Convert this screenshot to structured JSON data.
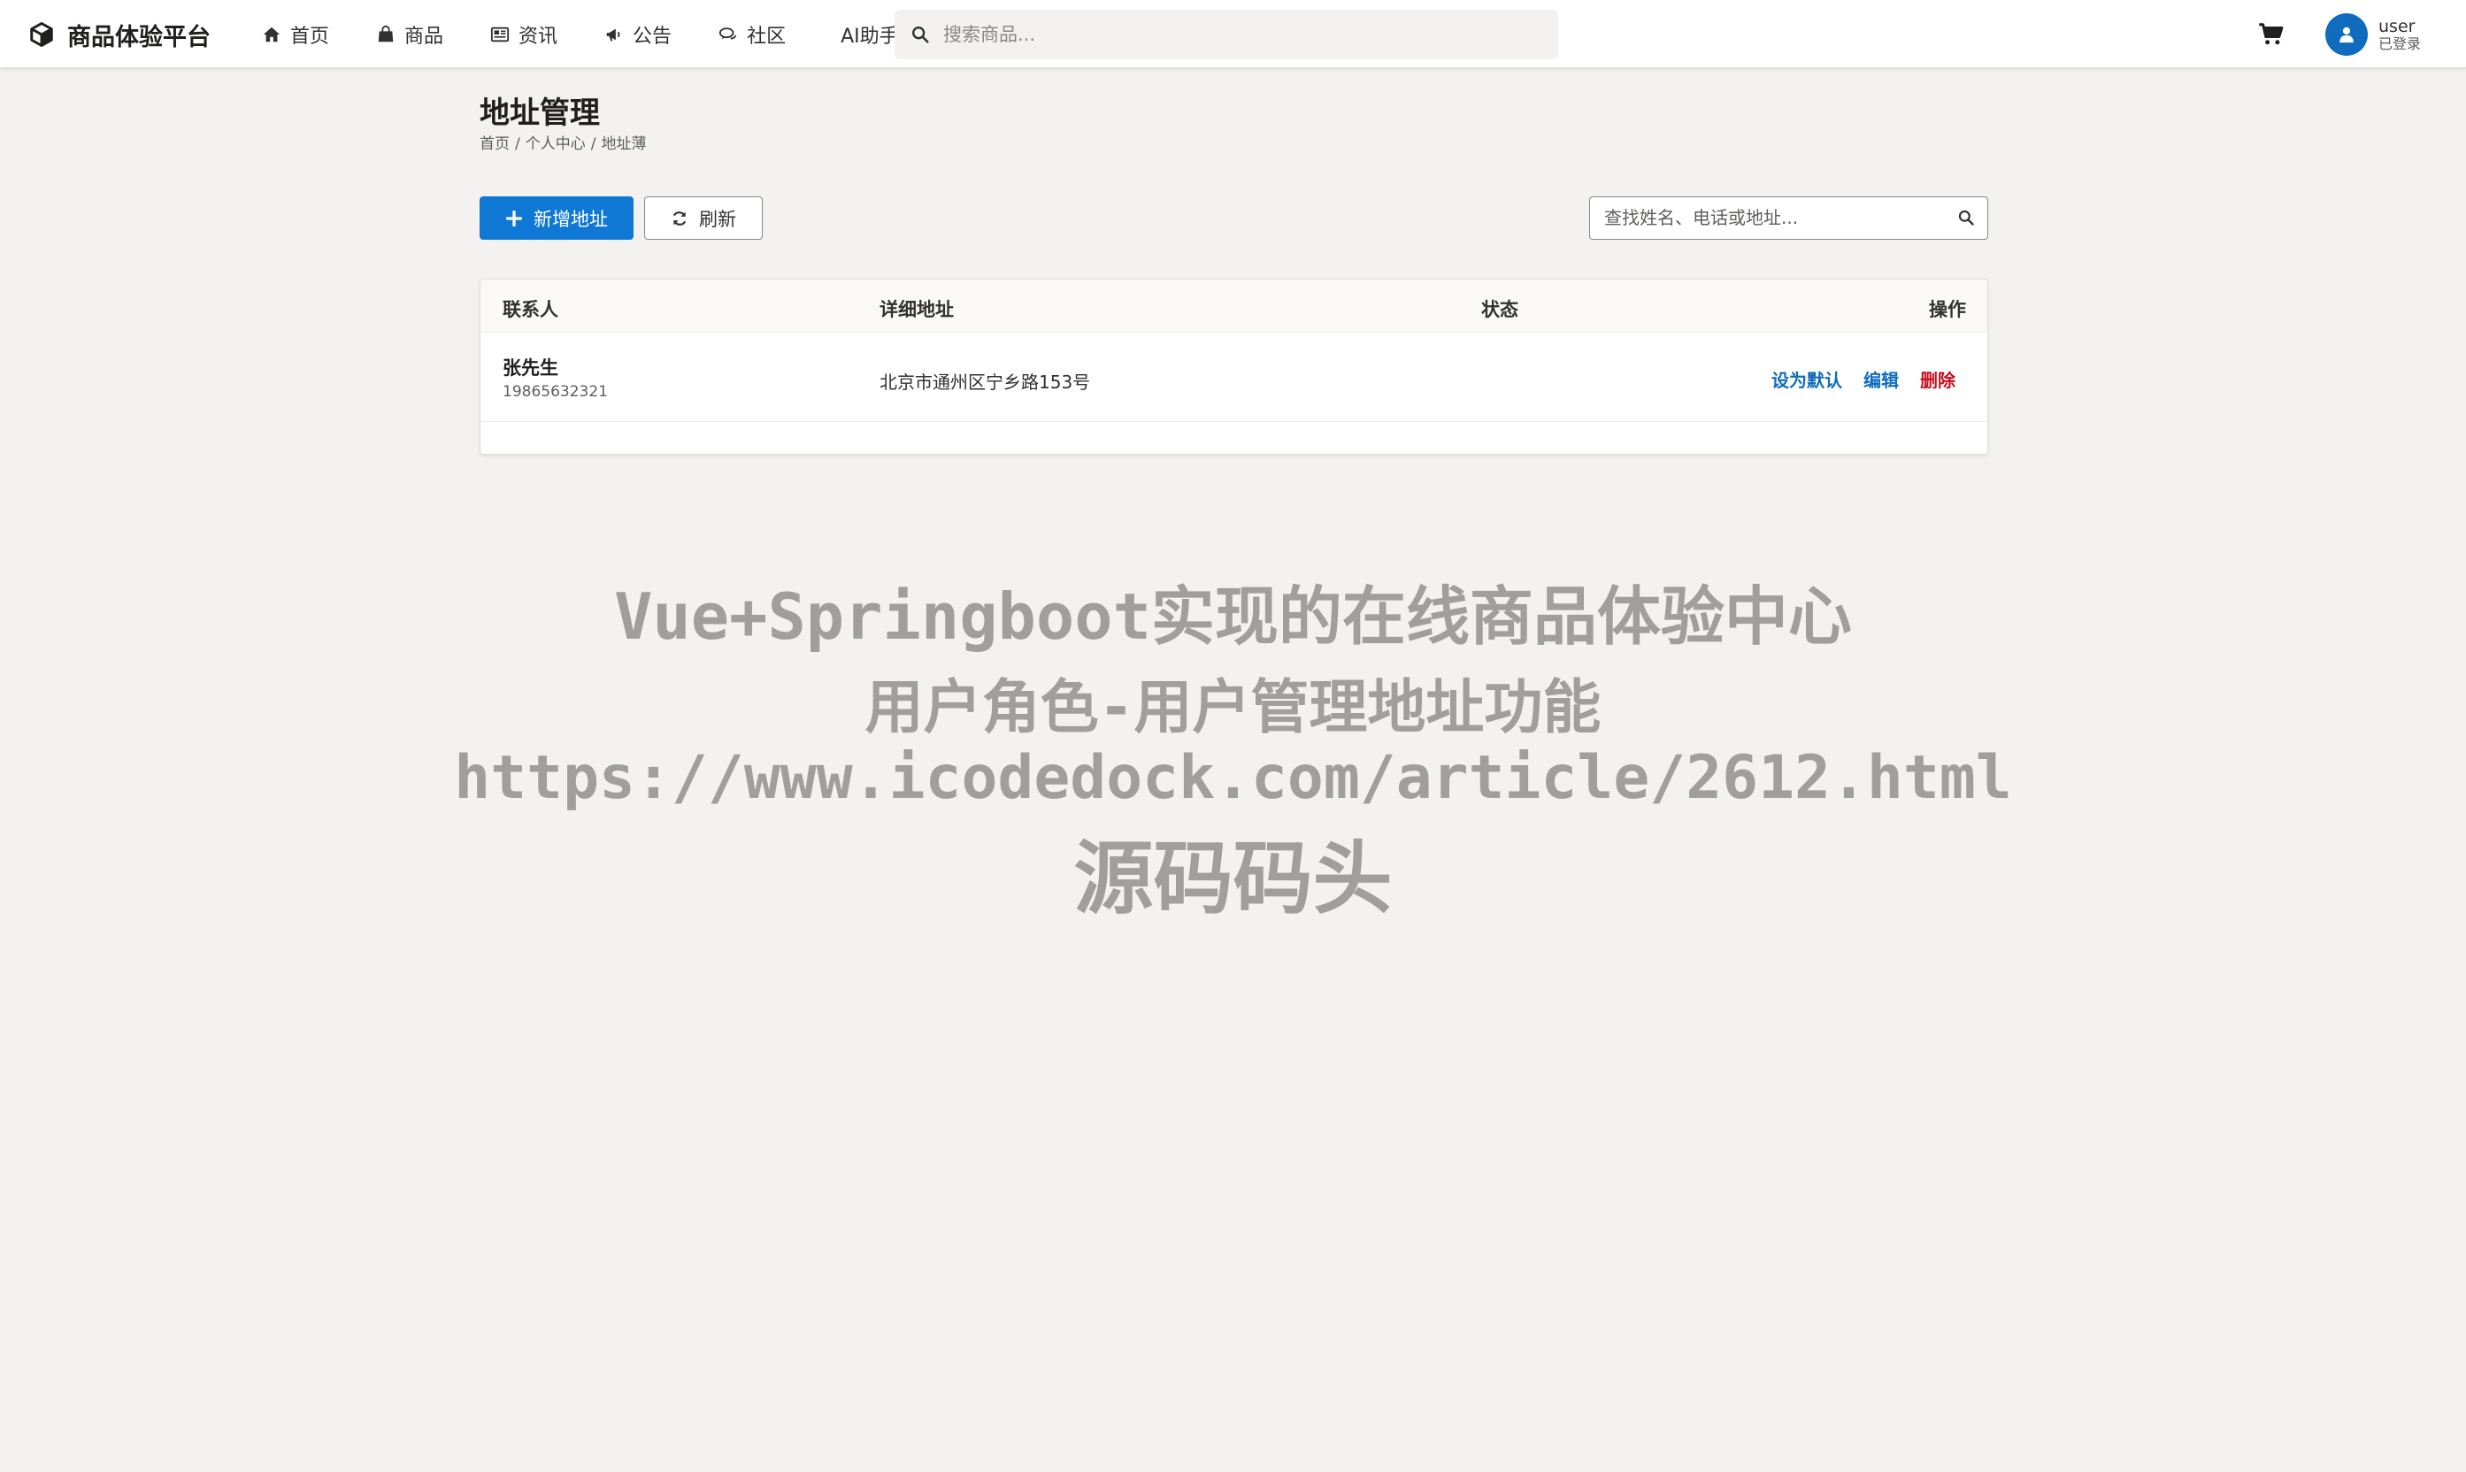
{
  "brand": {
    "title": "商品体验平台",
    "icon": "cube-icon"
  },
  "nav": {
    "items": [
      {
        "label": "首页",
        "icon": "home-icon"
      },
      {
        "label": "商品",
        "icon": "shopping-bag-icon"
      },
      {
        "label": "资讯",
        "icon": "newspaper-icon"
      },
      {
        "label": "公告",
        "icon": "bullhorn-icon"
      },
      {
        "label": "社区",
        "icon": "comments-icon"
      },
      {
        "label": "AI助手"
      }
    ]
  },
  "search": {
    "placeholder": "搜索商品...",
    "value": ""
  },
  "cart": {
    "icon": "cart-icon"
  },
  "user": {
    "name": "user",
    "status": "已登录",
    "icon": "user-icon"
  },
  "page": {
    "title": "地址管理",
    "breadcrumb": [
      "首页",
      "个人中心",
      "地址薄"
    ]
  },
  "toolbar": {
    "add_label": "新增地址",
    "refresh_label": "刷新",
    "search_placeholder": "查找姓名、电话或地址..."
  },
  "table": {
    "columns": {
      "contact": "联系人",
      "address": "详细地址",
      "status": "状态",
      "actions": "操作"
    },
    "rows": [
      {
        "name": "张先生",
        "phone": "19865632321",
        "address": "北京市通州区宁乡路153号",
        "status": "",
        "actions": {
          "set_default": "设为默认",
          "edit": "编辑",
          "delete": "删除"
        }
      }
    ]
  },
  "watermark": {
    "line1": "Vue+Springboot实现的在线商品体验中心",
    "line2": "用户角色-用户管理地址功能",
    "line3": "https://www.icodedock.com/article/2612.html",
    "line4": "源码码头"
  },
  "colors": {
    "primary": "#0f78d4",
    "link": "#0f6cbd",
    "danger": "#c50f1f",
    "background": "#f3f2f1"
  }
}
